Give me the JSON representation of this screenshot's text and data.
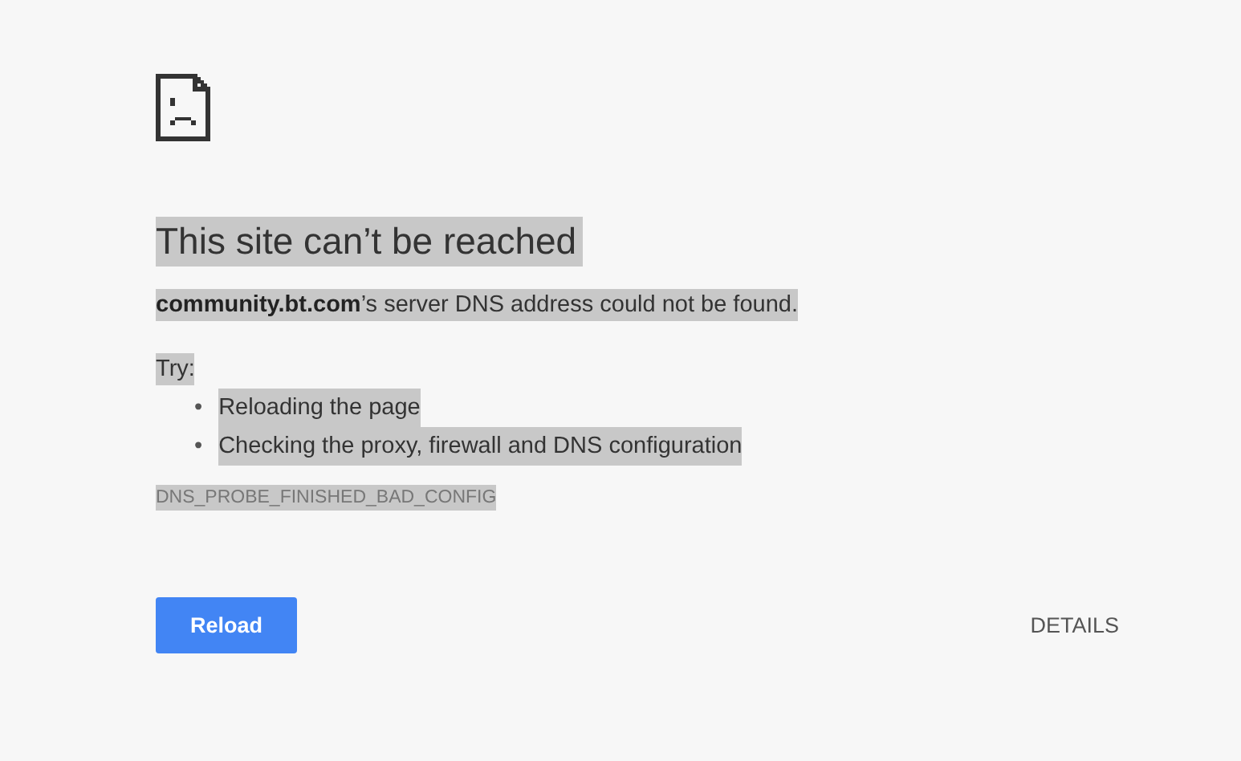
{
  "text_selected": true,
  "heading": "This site can’t be reached",
  "summary": "**community.bt.com**’s server DNS address could not be found.",
  "suggestions_label": "Try:",
  "suggestions": [
    {
      "bullet": "•",
      "text": "Reloading the page"
    },
    {
      "bullet": "•",
      "text": "Checking the proxy, firewall and DNS configuration"
    }
  ],
  "error_code": "DNS_PROBE_FINISHED_BAD_CONFIG",
  "buttons": {
    "reload": "Reload",
    "details": "DETAILS"
  }
}
